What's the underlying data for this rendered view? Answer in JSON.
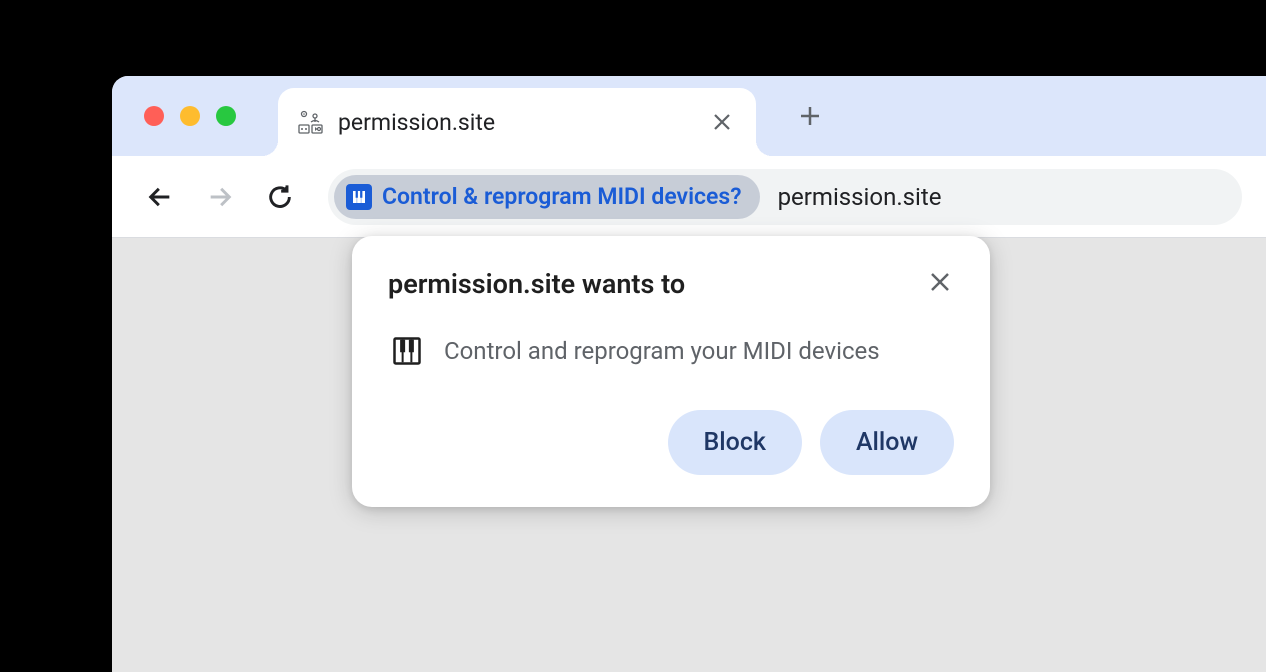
{
  "tab": {
    "title": "permission.site"
  },
  "addressBar": {
    "permissionChip": "Control & reprogram MIDI devices?",
    "url": "permission.site"
  },
  "popup": {
    "title": "permission.site wants to",
    "permissionText": "Control and reprogram your MIDI devices",
    "blockLabel": "Block",
    "allowLabel": "Allow"
  }
}
